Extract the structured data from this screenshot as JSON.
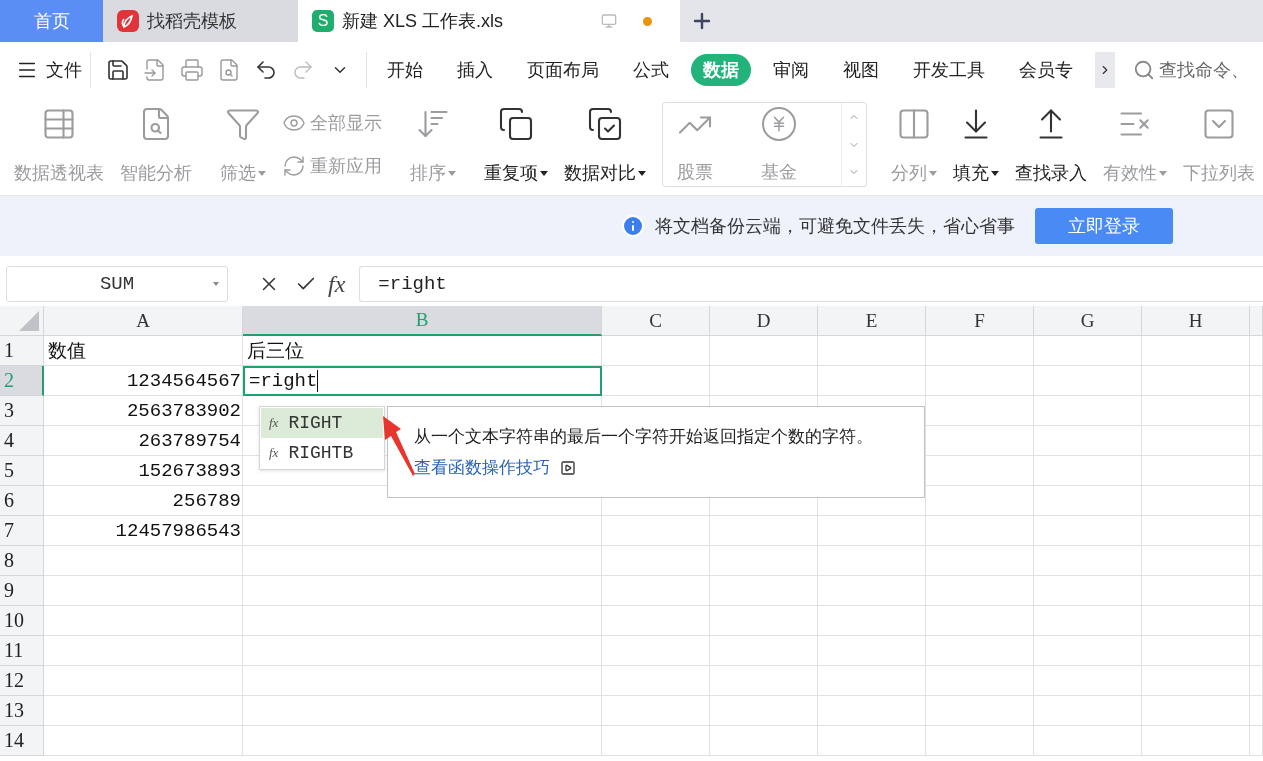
{
  "tabs": [
    {
      "kind": "home",
      "label": "首页",
      "selected": false
    },
    {
      "kind": "template",
      "label": "找稻壳模板",
      "selected": false
    },
    {
      "kind": "sheet",
      "label": "新建 XLS 工作表.xls",
      "icon_letter": "S",
      "selected": true,
      "unsaved": true
    }
  ],
  "file_menu": "文件",
  "menu_tabs": [
    {
      "label": "开始",
      "selected": false
    },
    {
      "label": "插入",
      "selected": false
    },
    {
      "label": "页面布局",
      "selected": false
    },
    {
      "label": "公式",
      "selected": false
    },
    {
      "label": "数据",
      "selected": true
    },
    {
      "label": "审阅",
      "selected": false
    },
    {
      "label": "视图",
      "selected": false
    },
    {
      "label": "开发工具",
      "selected": false
    },
    {
      "label": "会员专",
      "selected": false
    }
  ],
  "search": {
    "placeholder": "查找命令、"
  },
  "ribbon_groups": [
    {
      "kind": "plain",
      "items": [
        {
          "kind": "large",
          "label": "数据透视表",
          "disabled": true,
          "dropdown": false
        },
        {
          "kind": "large",
          "label": "智能分析",
          "disabled": true,
          "dropdown": false
        }
      ]
    },
    {
      "kind": "plain",
      "items": [
        {
          "kind": "large",
          "label": "筛选",
          "disabled": true,
          "dropdown": true
        },
        {
          "kind": "small",
          "label": "全部显示",
          "disabled": true,
          "dropdown": false
        },
        {
          "kind": "small",
          "label": "重新应用",
          "disabled": true,
          "dropdown": false
        }
      ]
    },
    {
      "kind": "plain",
      "items": [
        {
          "kind": "large",
          "label": "排序",
          "disabled": true,
          "dropdown": true
        }
      ]
    },
    {
      "kind": "plain",
      "items": [
        {
          "kind": "large",
          "label": "重复项",
          "disabled": false,
          "dropdown": true
        },
        {
          "kind": "large",
          "label": "数据对比",
          "disabled": false,
          "dropdown": true
        }
      ]
    },
    {
      "kind": "gallery",
      "items": [
        {
          "kind": "large",
          "label": "股票",
          "disabled": true,
          "dropdown": false
        },
        {
          "kind": "large",
          "label": "基金",
          "disabled": true,
          "dropdown": false
        }
      ]
    },
    {
      "kind": "plain",
      "items": [
        {
          "kind": "large",
          "label": "分列",
          "disabled": true,
          "dropdown": true
        },
        {
          "kind": "large",
          "label": "填充",
          "disabled": false,
          "dropdown": true
        },
        {
          "kind": "large",
          "label": "查找录入",
          "disabled": false,
          "dropdown": false
        },
        {
          "kind": "large",
          "label": "有效性",
          "disabled": true,
          "dropdown": true
        },
        {
          "kind": "large",
          "label": "下拉列表",
          "disabled": true,
          "dropdown": false
        }
      ]
    }
  ],
  "notice": {
    "text": "将文档备份云端，可避免文件丢失，省心省事",
    "button": "立即登录"
  },
  "formula_bar": {
    "name_box": "SUM",
    "fx": "fx",
    "value": "=right"
  },
  "sheet": {
    "columns": [
      {
        "label": "A",
        "selected": false
      },
      {
        "label": "B",
        "selected": true
      },
      {
        "label": "C",
        "selected": false
      },
      {
        "label": "D",
        "selected": false
      },
      {
        "label": "E",
        "selected": false
      },
      {
        "label": "F",
        "selected": false
      },
      {
        "label": "G",
        "selected": false
      },
      {
        "label": "H",
        "selected": false
      }
    ],
    "rows": [
      {
        "label": "1",
        "selected": false,
        "cells": [
          {
            "kind": "text",
            "text": "数值"
          },
          {
            "kind": "text",
            "text": "后三位"
          }
        ]
      },
      {
        "label": "2",
        "selected": true,
        "cells": [
          {
            "kind": "number",
            "text": "1234564567"
          },
          {
            "kind": "editing",
            "text": "=right"
          }
        ]
      },
      {
        "label": "3",
        "selected": false,
        "cells": [
          {
            "kind": "number",
            "text": "2563783902"
          }
        ]
      },
      {
        "label": "4",
        "selected": false,
        "cells": [
          {
            "kind": "number",
            "text": "263789754"
          }
        ]
      },
      {
        "label": "5",
        "selected": false,
        "cells": [
          {
            "kind": "number",
            "text": "152673893"
          }
        ]
      },
      {
        "label": "6",
        "selected": false,
        "cells": [
          {
            "kind": "number",
            "text": "256789"
          }
        ]
      },
      {
        "label": "7",
        "selected": false,
        "cells": [
          {
            "kind": "number",
            "text": "12457986543"
          }
        ]
      },
      {
        "label": "8",
        "selected": false,
        "cells": []
      },
      {
        "label": "9",
        "selected": false,
        "cells": []
      },
      {
        "label": "10",
        "selected": false,
        "cells": []
      },
      {
        "label": "11",
        "selected": false,
        "cells": []
      },
      {
        "label": "12",
        "selected": false,
        "cells": []
      },
      {
        "label": "13",
        "selected": false,
        "cells": []
      },
      {
        "label": "14",
        "selected": false,
        "cells": []
      }
    ]
  },
  "suggestions": [
    {
      "prefix": "fx",
      "name": "RIGHT",
      "selected": true
    },
    {
      "prefix": "fx",
      "name": "RIGHTB",
      "selected": false
    }
  ],
  "tooltip": {
    "description": "从一个文本字符串的最后一个字符开始返回指定个数的字符。",
    "link": "查看函数操作技巧"
  }
}
